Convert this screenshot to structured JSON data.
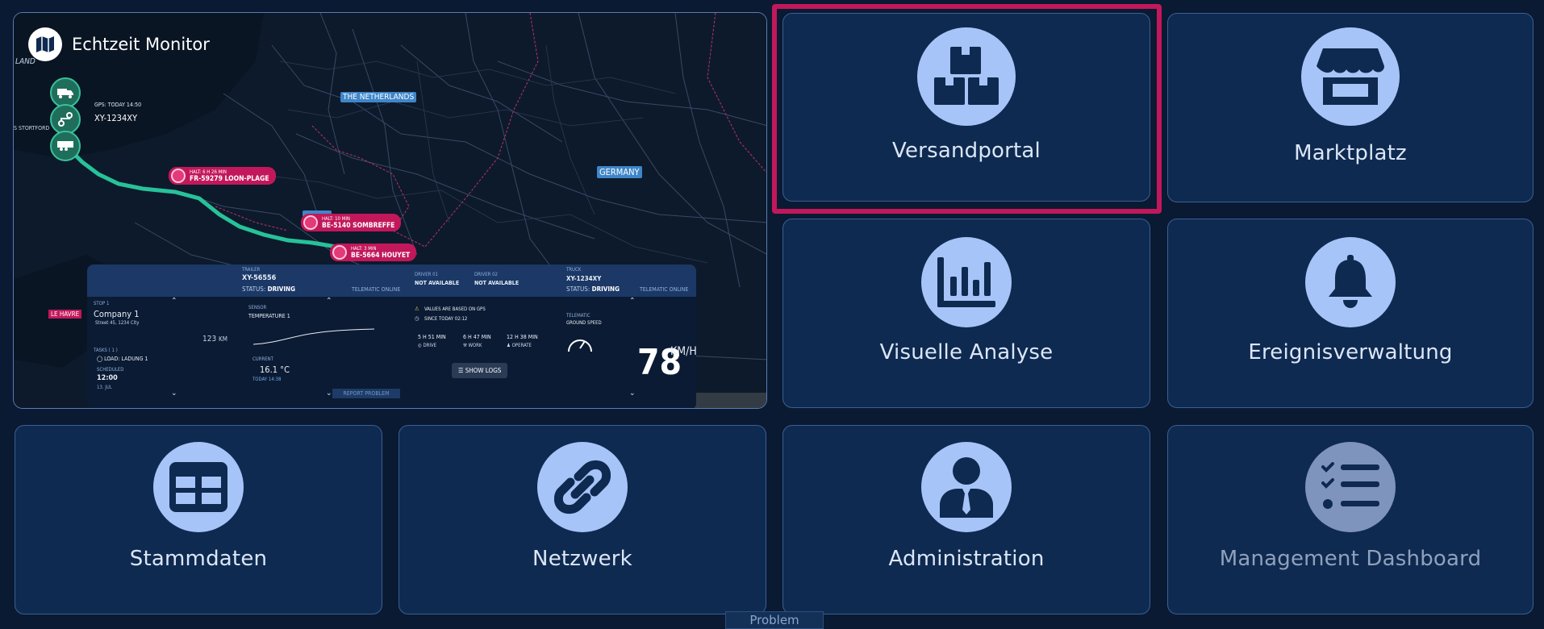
{
  "map": {
    "title": "Echtzeit Monitor",
    "fragments": {
      "land": "LAND",
      "storford": "S STORTFORD"
    },
    "gps_time": "GPS: TODAY 14:50",
    "plate": "XY-1234XY",
    "countries": {
      "netherlands": "THE NETHERLANDS",
      "germany": "GERMANY",
      "le_havre": "LE HAVRE"
    },
    "pins": [
      {
        "small": "HALT: 6 H 26 MIN",
        "big": "FR-59279 LOON-PLAGE"
      },
      {
        "small": "HALT: 10 MIN",
        "big": "BE-5140 SOMBREFFE"
      },
      {
        "small": "HALT: 3 MIN",
        "big": "BE-5664 HOUYET"
      }
    ],
    "panel": {
      "trailer_label": "TRAILER",
      "trailer_id": "XY-56556",
      "status_label": "STATUS:",
      "status_value": "DRIVING",
      "telematic": "TELEMATIC ONLINE",
      "driver1_label": "DRIVER 01",
      "driver1_value": "NOT AVAILABLE",
      "driver2_label": "DRIVER 02",
      "driver2_value": "NOT AVAILABLE",
      "truck_label": "TRUCK",
      "truck_id": "XY-1234XY",
      "truck_status_label": "STATUS:",
      "truck_status_value": "DRIVING",
      "truck_telematic": "TELEMATIC ONLINE",
      "stop_label": "STOP 1",
      "company": "Company 1",
      "street": "Street 45, 1234 City",
      "distance": "123",
      "distance_unit": "KM",
      "tasks_label": "TASKS ( 1 )",
      "task": "LOAD: LADUNG 1",
      "scheduled_label": "SCHEDULED",
      "scheduled_time": "12:00",
      "scheduled_date": "13. JUL",
      "sensor_label": "SENSOR",
      "sensor_name": "TEMPERATURE 1",
      "current_label": "CURRENT",
      "temperature": "16.1 °C",
      "temp_time": "TODAY 14:38",
      "gps_note": "VALUES ARE BASED ON GPS",
      "since": "SINCE TODAY 02:12",
      "drive_value": "5 H 51 MIN",
      "drive_label": "DRIVE",
      "work_value": "6 H 47 MIN",
      "work_label": "WORK",
      "operate_value": "12 H 38 MIN",
      "operate_label": "OPERATE",
      "show_logs": "SHOW LOGS",
      "telematic_label": "TELEMATIC",
      "ground_speed_label": "GROUND SPEED",
      "speed": "78",
      "speed_unit": "KM/H"
    },
    "report_problem": "REPORT PROBLEM"
  },
  "tiles": [
    {
      "label": "Versandportal",
      "icon": "boxes-icon"
    },
    {
      "label": "Marktplatz",
      "icon": "store-icon"
    },
    {
      "label": "Visuelle Analyse",
      "icon": "bar-chart-icon"
    },
    {
      "label": "Ereignisverwaltung",
      "icon": "bell-icon"
    },
    {
      "label": "Stammdaten",
      "icon": "table-icon"
    },
    {
      "label": "Netzwerk",
      "icon": "link-icon"
    },
    {
      "label": "Administration",
      "icon": "user-tie-icon"
    },
    {
      "label": "Management Dashboard",
      "icon": "checklist-icon"
    }
  ],
  "footer": {
    "problem": "Problem"
  },
  "colors": {
    "background": "#0a1a33",
    "tile": "#0f2a50",
    "icon_circle": "#a6c4f7",
    "highlight": "#c2185b",
    "route": "#27c29a"
  }
}
